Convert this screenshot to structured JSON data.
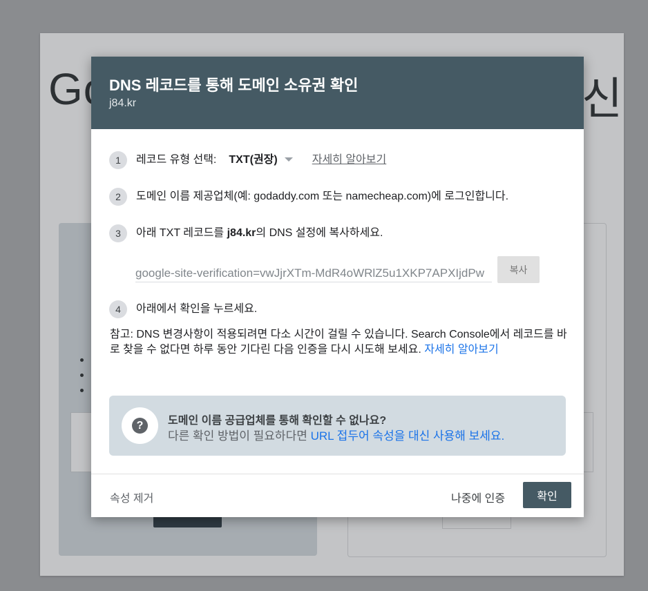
{
  "background": {
    "title_left": "Go",
    "title_right": "신"
  },
  "dialog": {
    "title": "DNS 레코드를 통해 도메인 소유권 확인",
    "subtitle": "j84.kr",
    "steps": [
      {
        "num": "1",
        "label": "레코드 유형 선택:",
        "record_type": "TXT(권장)",
        "learn_more": "자세히 알아보기"
      },
      {
        "num": "2",
        "text": "도메인 이름 제공업체(예: godaddy.com 또는 namecheap.com)에 로그인합니다."
      },
      {
        "num": "3",
        "text_before": "아래 TXT 레코드를 ",
        "domain": "j84.kr",
        "text_after": "의 DNS 설정에 복사하세요."
      },
      {
        "num": "4",
        "text": "아래에서 확인을 누르세요."
      }
    ],
    "txt_record": "google-site-verification=vwJjrXTm-MdR4oWRlZ5u1XKP7APXIjdPw",
    "copy_label": "복사",
    "note_text": "참고: DNS 변경사항이 적용되려면 다소 시간이 걸릴 수 있습니다. Search Console에서 레코드를 바로 찾을 수 없다면 하루 동안 기다린 다음 인증을 다시 시도해 보세요. ",
    "note_link": "자세히 알아보기",
    "info": {
      "icon": "question-icon",
      "title": "도메인 이름 공급업체를 통해 확인할 수 없나요?",
      "text": "다른 확인 방법이 필요하다면 ",
      "link": "URL 접두어 속성을 대신 사용해 보세요."
    },
    "footer": {
      "remove_label": "속성 제거",
      "later_label": "나중에 인증",
      "confirm_label": "확인"
    }
  },
  "colors": {
    "header": "#455a64",
    "link": "#1a73e8",
    "info_bg": "#d2dbe1"
  }
}
